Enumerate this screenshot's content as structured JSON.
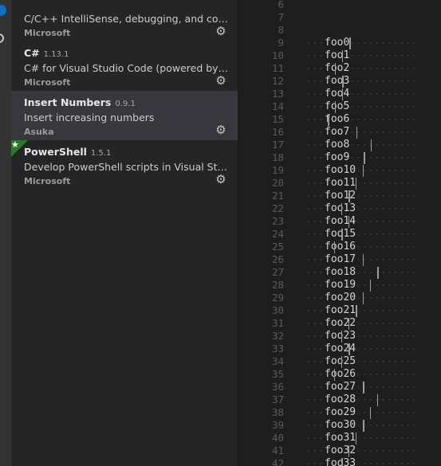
{
  "sidebar": {
    "extensions": [
      {
        "name": "",
        "version": "",
        "description": "C/C++ IntelliSense, debugging, and code browsing.",
        "publisher": "Microsoft",
        "selected": false,
        "starred": false
      },
      {
        "name": "C#",
        "version": "1.13.1",
        "description": "C# for Visual Studio Code (powered by OmniSharp).",
        "publisher": "Microsoft",
        "selected": false,
        "starred": false
      },
      {
        "name": "Insert Numbers",
        "version": "0.9.1",
        "description": "Insert increasing numbers",
        "publisher": "Asuka",
        "selected": true,
        "starred": false
      },
      {
        "name": "PowerShell",
        "version": "1.5.1",
        "description": "Develop PowerShell scripts in Visual Studio Code!",
        "publisher": "Microsoft",
        "selected": false,
        "starred": true
      }
    ],
    "manage_icon": "gear-icon",
    "star_icon": "star-icon"
  },
  "editor": {
    "empty_line_numbers": [
      "6",
      "7",
      "8"
    ],
    "lines": [
      {
        "number": "9",
        "text": "foo0"
      },
      {
        "number": "10",
        "text": "foo1"
      },
      {
        "number": "11",
        "text": "foo2"
      },
      {
        "number": "12",
        "text": "foo3"
      },
      {
        "number": "13",
        "text": "foo4"
      },
      {
        "number": "14",
        "text": "foo5"
      },
      {
        "number": "15",
        "text": "foo6"
      },
      {
        "number": "16",
        "text": "foo7"
      },
      {
        "number": "17",
        "text": "foo8"
      },
      {
        "number": "18",
        "text": "foo9"
      },
      {
        "number": "19",
        "text": "foo10"
      },
      {
        "number": "20",
        "text": "foo11"
      },
      {
        "number": "21",
        "text": "foo12"
      },
      {
        "number": "22",
        "text": "foo13"
      },
      {
        "number": "23",
        "text": "foo14"
      },
      {
        "number": "24",
        "text": "foo15"
      },
      {
        "number": "25",
        "text": "foo16"
      },
      {
        "number": "26",
        "text": "foo17"
      },
      {
        "number": "27",
        "text": "foo18"
      },
      {
        "number": "28",
        "text": "foo19"
      },
      {
        "number": "29",
        "text": "foo20"
      },
      {
        "number": "30",
        "text": "foo21"
      },
      {
        "number": "31",
        "text": "foo22"
      },
      {
        "number": "32",
        "text": "foo23"
      },
      {
        "number": "33",
        "text": "foo24"
      },
      {
        "number": "34",
        "text": "foo25"
      },
      {
        "number": "35",
        "text": "foo26"
      },
      {
        "number": "36",
        "text": "foo27"
      },
      {
        "number": "37",
        "text": "foo28"
      },
      {
        "number": "38",
        "text": "foo29"
      },
      {
        "number": "39",
        "text": "foo30"
      },
      {
        "number": "40",
        "text": "foo31"
      },
      {
        "number": "41",
        "text": "foo32"
      },
      {
        "number": "42",
        "text": "foo33"
      }
    ]
  },
  "colors": {
    "editor_background": "#1e1e1e",
    "sidebar_background": "#252526",
    "selected_item": "#37373d",
    "activity_badge": "#0e70c0",
    "star_badge": "#2b7a2b"
  }
}
